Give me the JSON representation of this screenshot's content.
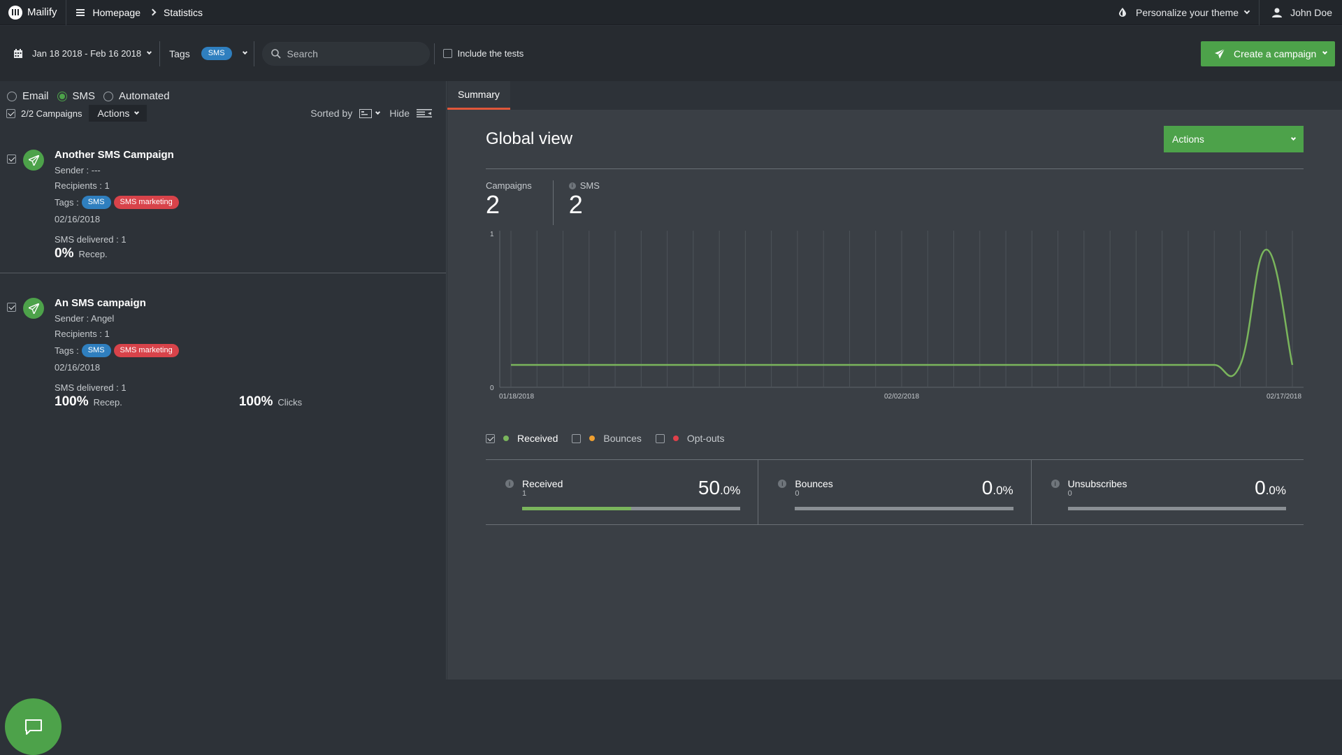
{
  "app": {
    "brand": "Mailify",
    "breadcrumb": [
      "Homepage",
      "Statistics"
    ],
    "theme_label": "Personalize your theme",
    "user_name": "John Doe"
  },
  "filters": {
    "date_range": "Jan 18 2018 - Feb 16 2018",
    "tags_label": "Tags",
    "selected_tag": "SMS",
    "search_placeholder": "Search",
    "include_tests_label": "Include the tests",
    "include_tests_checked": false,
    "create_button": "Create a campaign"
  },
  "left": {
    "types": [
      {
        "label": "Email",
        "selected": false
      },
      {
        "label": "SMS",
        "selected": true
      },
      {
        "label": "Automated",
        "selected": false
      }
    ],
    "campaign_count": "2/2 Campaigns",
    "actions_label": "Actions",
    "sorted_by_label": "Sorted by",
    "hide_label": "Hide",
    "campaigns": [
      {
        "title": "Another SMS Campaign",
        "sender": "Sender : ---",
        "recipients": "Recipients : 1",
        "tags_label": "Tags :",
        "tags": [
          "SMS",
          "SMS marketing"
        ],
        "date": "02/16/2018",
        "delivered": "SMS delivered : 1",
        "recep_value": "0%",
        "recep_label": "Recep."
      },
      {
        "title": "An SMS campaign",
        "sender": "Sender : Angel",
        "recipients": "Recipients : 1",
        "tags_label": "Tags :",
        "tags": [
          "SMS",
          "SMS marketing"
        ],
        "date": "02/16/2018",
        "delivered": "SMS delivered : 1",
        "recep_value": "100%",
        "recep_label": "Recep.",
        "clicks_value": "100%",
        "clicks_label": "Clicks"
      }
    ]
  },
  "right": {
    "tab": "Summary",
    "title": "Global view",
    "actions_label": "Actions",
    "kpis": [
      {
        "label": "Campaigns",
        "value": "2"
      },
      {
        "label": "SMS",
        "value": "2"
      }
    ],
    "legend": [
      {
        "label": "Received",
        "checked": true,
        "color": "#7ab55c"
      },
      {
        "label": "Bounces",
        "checked": false,
        "color": "#f0a030"
      },
      {
        "label": "Opt-outs",
        "checked": false,
        "color": "#e0404a"
      }
    ],
    "metrics": [
      {
        "name": "Received",
        "sub": "1",
        "value_int": "50",
        "value_dec": ".0%",
        "fill_percent": 50
      },
      {
        "name": "Bounces",
        "sub": "0",
        "value_int": "0",
        "value_dec": ".0%",
        "fill_percent": 0
      },
      {
        "name": "Unsubscribes",
        "sub": "0",
        "value_int": "0",
        "value_dec": ".0%",
        "fill_percent": 0
      }
    ]
  },
  "chart_data": {
    "type": "line",
    "x_labels": [
      "01/18/2018",
      "02/02/2018",
      "02/17/2018"
    ],
    "ylim": [
      0,
      1
    ],
    "y_ticks": [
      "0",
      "1"
    ],
    "series": [
      {
        "name": "Received",
        "color": "#7ab55c",
        "x": [
          "01/18/2018",
          "01/19/2018",
          "01/20/2018",
          "01/21/2018",
          "01/22/2018",
          "01/23/2018",
          "01/24/2018",
          "01/25/2018",
          "01/26/2018",
          "01/27/2018",
          "01/28/2018",
          "01/29/2018",
          "01/30/2018",
          "01/31/2018",
          "02/01/2018",
          "02/02/2018",
          "02/03/2018",
          "02/04/2018",
          "02/05/2018",
          "02/06/2018",
          "02/07/2018",
          "02/08/2018",
          "02/09/2018",
          "02/10/2018",
          "02/11/2018",
          "02/12/2018",
          "02/13/2018",
          "02/14/2018",
          "02/15/2018",
          "02/16/2018",
          "02/17/2018"
        ],
        "values": [
          0,
          0,
          0,
          0,
          0,
          0,
          0,
          0,
          0,
          0,
          0,
          0,
          0,
          0,
          0,
          0,
          0,
          0,
          0,
          0,
          0,
          0,
          0,
          0,
          0,
          0,
          0,
          0,
          0,
          1,
          0
        ]
      }
    ],
    "grid": true
  }
}
